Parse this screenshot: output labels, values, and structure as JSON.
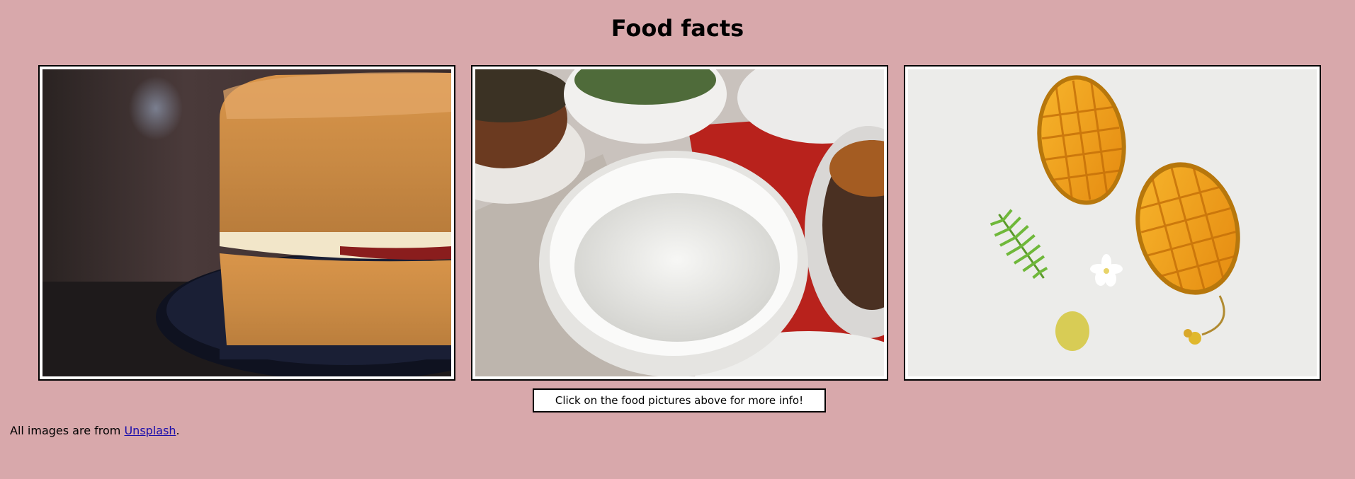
{
  "page": {
    "title": "Food facts",
    "hint": "Click on the food pictures above for more info!",
    "credit_prefix": "All images are from ",
    "credit_link": "Unsplash",
    "credit_suffix": "."
  },
  "gallery": {
    "items": [
      {
        "name": "cake",
        "alt": "Victoria sponge cake"
      },
      {
        "name": "rice",
        "alt": "Bowl of white rice with curry"
      },
      {
        "name": "mango",
        "alt": "Mangoes on white background"
      }
    ]
  },
  "colors": {
    "background": "#d8a8ab",
    "link": "#1a0dab"
  }
}
